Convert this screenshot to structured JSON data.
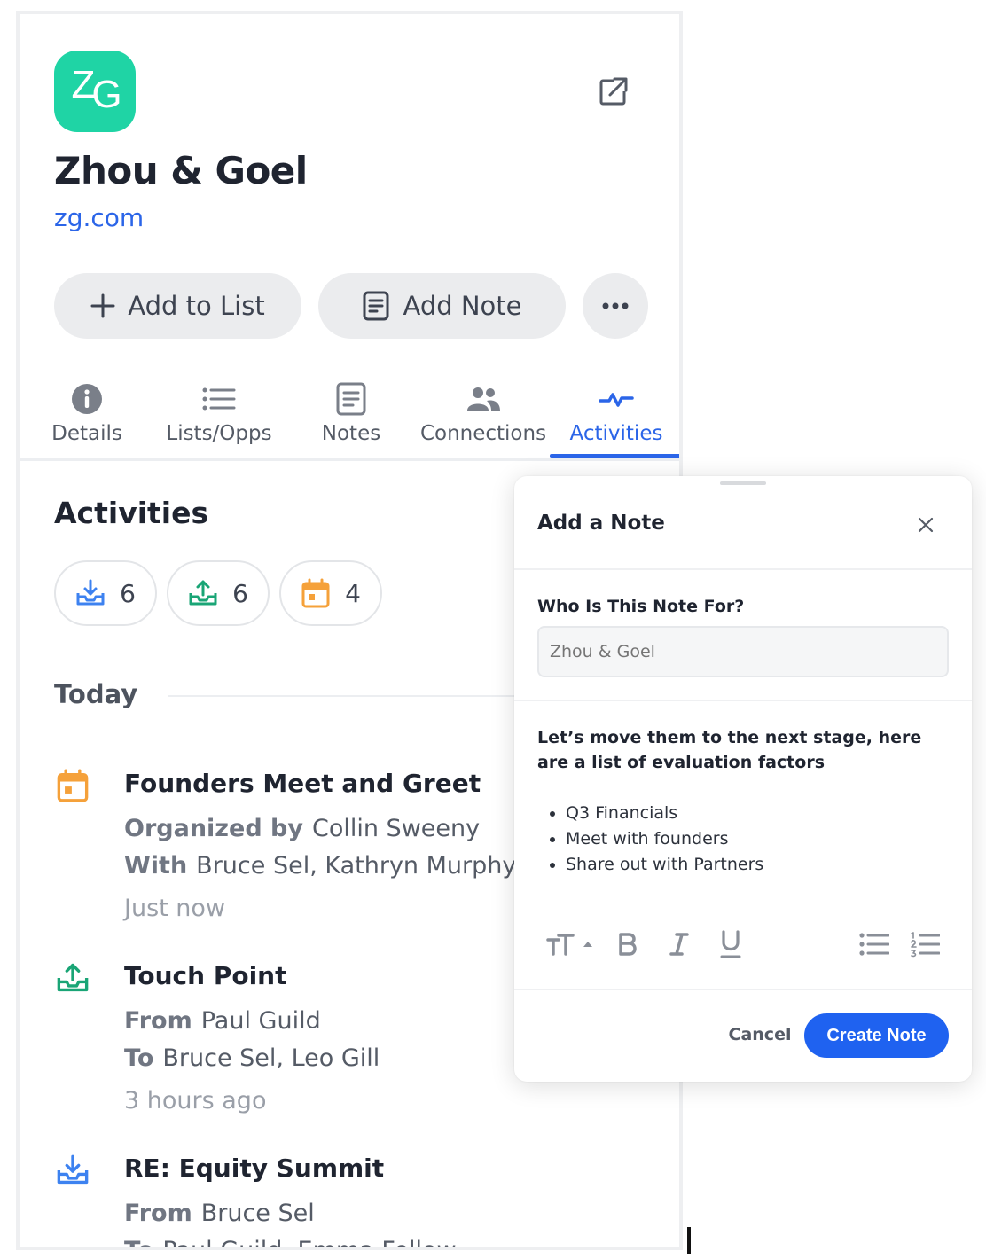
{
  "company": {
    "logo_initials_1": "Z",
    "logo_initials_2": "G",
    "name": "Zhou & Goel",
    "url": "zg.com"
  },
  "actions": {
    "add_to_list": "Add to List",
    "add_note": "Add Note"
  },
  "tabs": [
    {
      "label": "Details",
      "icon": "info-icon"
    },
    {
      "label": "Lists/Opps",
      "icon": "list-icon"
    },
    {
      "label": "Notes",
      "icon": "note-icon"
    },
    {
      "label": "Connections",
      "icon": "people-icon"
    },
    {
      "label": "Activities",
      "icon": "activity-icon",
      "active": true
    }
  ],
  "activities": {
    "title": "Activities",
    "counts": {
      "inbound": "6",
      "outbound": "6",
      "meetings": "4"
    },
    "day": "Today",
    "items": [
      {
        "title": "Founders Meet and Greet",
        "line1_key": "Organized by",
        "line1_val": "Collin Sweeny",
        "line2_key": "With",
        "line2_val": "Bruce Sel, Kathryn Murphy",
        "time": "Just now"
      },
      {
        "title": "Touch Point",
        "line1_key": "From",
        "line1_val": "Paul Guild",
        "line2_key": "To",
        "line2_val": "Bruce Sel, Leo Gill",
        "time": "3 hours ago"
      },
      {
        "title": "RE: Equity Summit",
        "line1_key": "From",
        "line1_val": "Bruce Sel",
        "line2_key": "To",
        "line2_val": "Paul Guild, Emma Fellow"
      }
    ]
  },
  "modal": {
    "title": "Add a Note",
    "for_label": "Who Is This Note For?",
    "for_placeholder": "Zhou & Goel",
    "body": "Let’s move them to the next stage, here are a list of evaluation factors",
    "bullets": [
      "Q3 Financials",
      "Meet with founders",
      "Share out with Partners"
    ],
    "cancel": "Cancel",
    "create": "Create Note"
  },
  "colors": {
    "accent": "#2b65e8",
    "logo_bg": "#1fd4a5",
    "meeting_orange": "#f5a13a",
    "outbound_green": "#1aa576",
    "inbound_blue": "#3d82f0"
  }
}
